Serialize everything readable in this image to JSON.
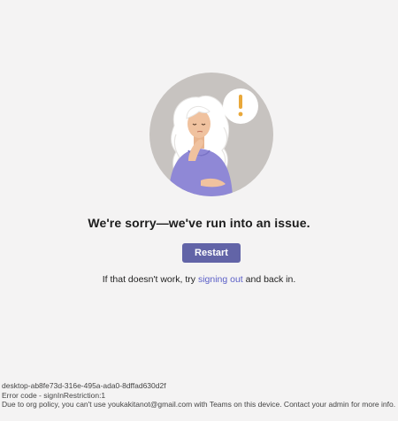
{
  "error_page": {
    "headline": "We're sorry—we've run into an issue.",
    "restart_label": "Restart",
    "retry_prefix": "If that doesn't work, try ",
    "signout_link": "signing out",
    "retry_suffix": " and back in."
  },
  "diagnostics": {
    "session_id": "desktop-ab8fe73d-316e-495a-ada0-8dffad630d2f",
    "error_code": "Error code - signInRestriction:1",
    "policy_message": "Due to org policy, you can't use youkakitanot@gmail.com with Teams on this device. Contact your admin for more info."
  },
  "colors": {
    "background": "#f4f3f3",
    "accent": "#6264a7",
    "link": "#5b5fc7",
    "illustration_circle": "#c7c3c0",
    "sweater": "#8f88d6",
    "exclamation": "#e9a83a"
  },
  "icons": {
    "illustration": "person-thinking-illustration",
    "alert": "exclamation-bubble-icon"
  }
}
